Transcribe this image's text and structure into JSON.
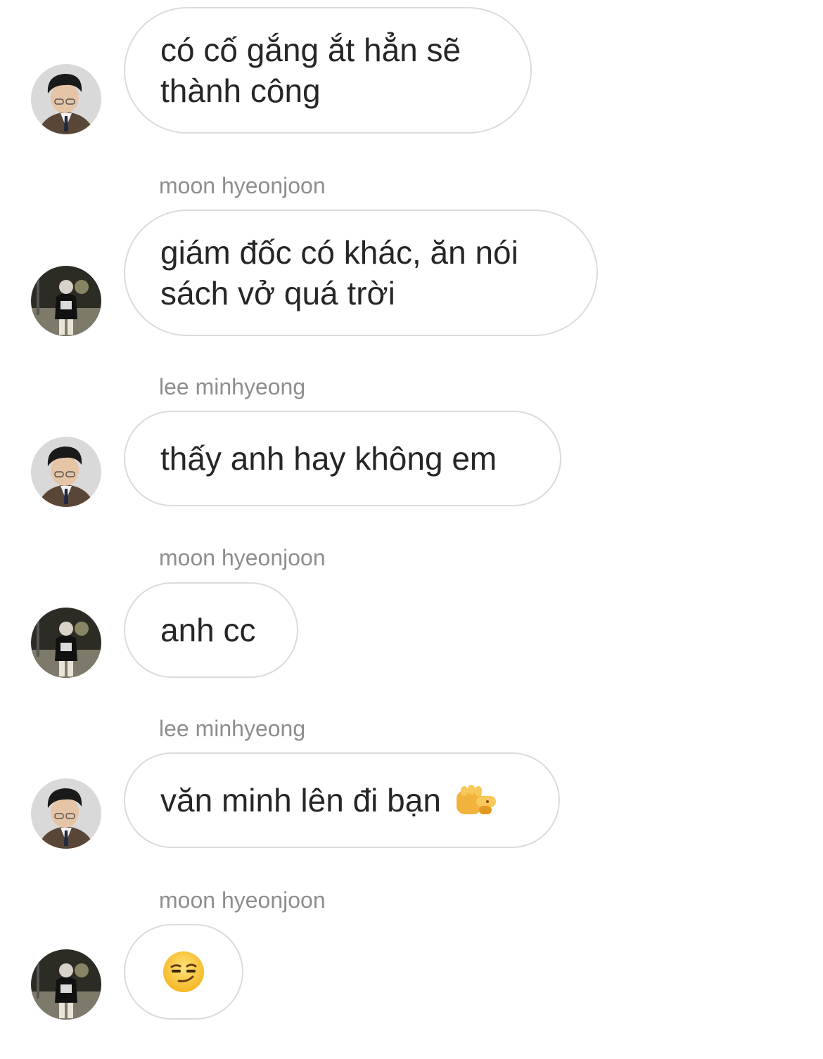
{
  "messages": [
    {
      "sender_name": "",
      "avatar": "user-a",
      "text": "có cố gắng ắt hẳn sẽ\nthành công"
    },
    {
      "sender_name": "moon hyeonjoon",
      "avatar": "user-b",
      "text": "giám đốc có khác, ăn nói\nsách vở quá trời"
    },
    {
      "sender_name": "lee minhyeong",
      "avatar": "user-a",
      "text": "thấy anh hay không em"
    },
    {
      "sender_name": "moon hyeonjoon",
      "avatar": "user-b",
      "text": "anh cc"
    },
    {
      "sender_name": "lee minhyeong",
      "avatar": "user-a",
      "text": "văn minh lên đi bạn",
      "trailing_emoji": "pointing-fist-emoji"
    },
    {
      "sender_name": "moon hyeonjoon",
      "avatar": "user-b",
      "text": "",
      "emoji": "smirking-face-emoji"
    }
  ],
  "colors": {
    "bubble_border": "#dbdbdb",
    "text": "#262626",
    "sender": "#8e8e8e"
  }
}
